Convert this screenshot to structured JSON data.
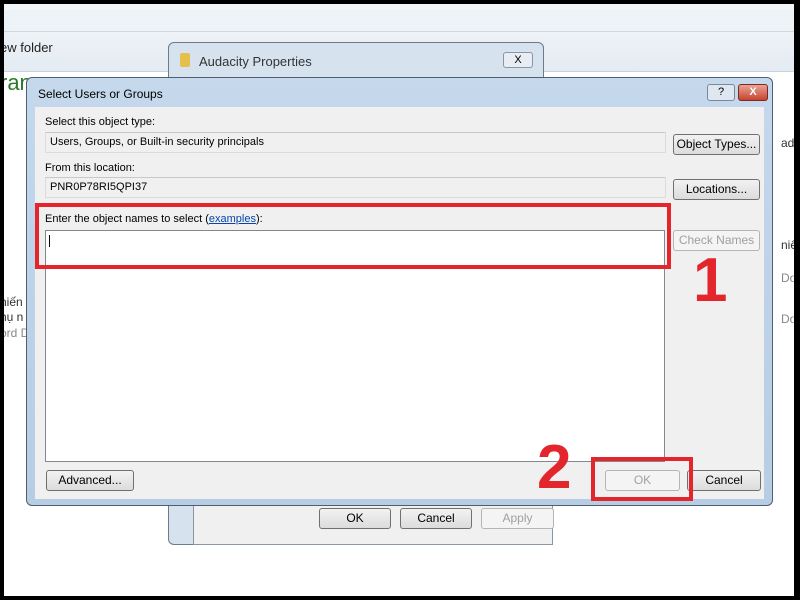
{
  "background": {
    "new_folder": "ew folder",
    "green_fragment": "ran",
    "left_texts": [
      "hiến",
      "hụ n",
      "ord D"
    ],
    "right_texts": [
      "ads",
      "niê",
      "Do",
      "Do"
    ]
  },
  "back_window": {
    "title": "Audacity Properties",
    "close": "X",
    "buttons": {
      "ok": "OK",
      "cancel": "Cancel",
      "apply": "Apply"
    }
  },
  "dialog": {
    "title": "Select Users or Groups",
    "help": "?",
    "close": "X",
    "object_type_label": "Select this object type:",
    "object_type_value": "Users, Groups, or Built-in security principals",
    "object_types_button": "Object Types...",
    "location_label": "From this location:",
    "location_value": "PNR0P78RI5QPI37",
    "locations_button": "Locations...",
    "names_label_prefix": "Enter the object names to select (",
    "names_label_link": "examples",
    "names_label_suffix": "):",
    "names_value": "",
    "check_names_button": "Check Names",
    "advanced_button": "Advanced...",
    "ok_button": "OK",
    "cancel_button": "Cancel"
  },
  "annotations": {
    "step1": "1",
    "step2": "2",
    "color": "#e3262b"
  }
}
